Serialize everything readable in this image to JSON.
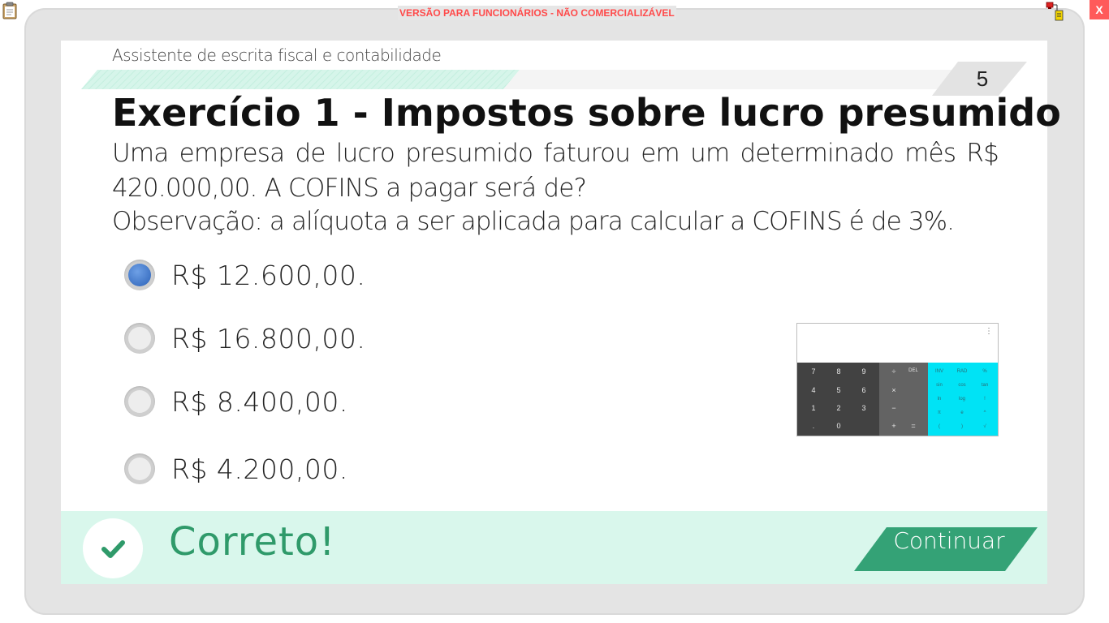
{
  "window": {
    "watermark": "VERSÃO PARA FUNCIONÁRIOS - NÃO COMERCIALIZÁVEL",
    "close_label": "X"
  },
  "course": {
    "title": "Assistente de escrita fiscal e contabilidade"
  },
  "page_number": "5",
  "exercise": {
    "title": "Exercício 1 - Impostos sobre lucro presumido",
    "question": "Uma empresa de lucro presumido faturou em um determinado mês R$ 420.000,00. A COFINS a pagar  será de?",
    "note": "Observação: a alíquota a ser aplicada para calcular a COFINS é de 3%."
  },
  "options": [
    {
      "label": "R$ 12.600,00.",
      "selected": true
    },
    {
      "label": "R$ 16.800,00.",
      "selected": false
    },
    {
      "label": "R$ 8.400,00.",
      "selected": false
    },
    {
      "label": "R$ 4.200,00.",
      "selected": false
    }
  ],
  "calculator": {
    "menu": "⋮",
    "digits": [
      "7",
      "8",
      "9",
      "4",
      "5",
      "6",
      "1",
      "2",
      "3",
      ".",
      "0"
    ],
    "ops": [
      "÷",
      "DEL",
      "×",
      "−",
      "+",
      "="
    ],
    "sci": [
      "INV",
      "RAD",
      "%",
      "sin",
      "cos",
      "tan",
      "ln",
      "log",
      "!",
      "π",
      "e",
      "^",
      "(",
      ")",
      "√"
    ]
  },
  "feedback": {
    "message": "Correto!",
    "continue_label": "Continuar"
  },
  "colors": {
    "feedback_bg": "#d9f7ec",
    "success_green": "#2f9a6a",
    "watermark_red": "#ff4a4a",
    "radio_selected": "#2c62b8"
  },
  "icons": [
    "clipboard-icon",
    "network-status-icon",
    "check-icon",
    "calculator-menu-icon"
  ]
}
